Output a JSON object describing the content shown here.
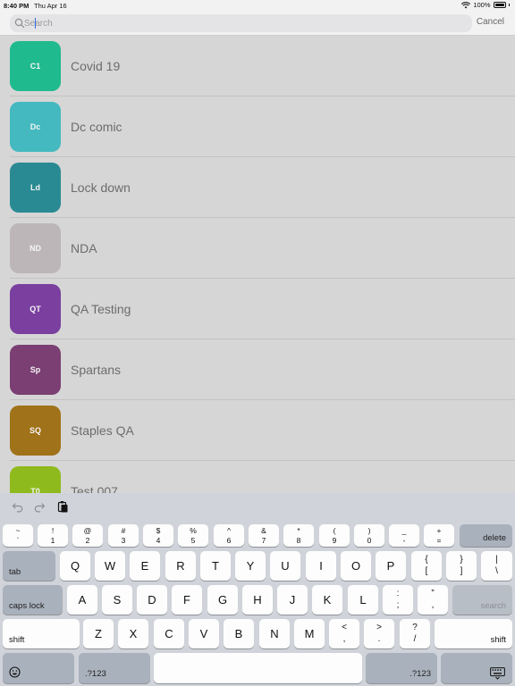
{
  "status_bar": {
    "time": "8:40 PM",
    "date": "Thu Apr 16",
    "battery": "100%"
  },
  "search": {
    "placeholder": "Search",
    "value": "",
    "cancel_label": "Cancel"
  },
  "colors": {
    "accent": "#2d6fe6",
    "list_bg": "#d6d6d6",
    "keyboard_bg": "#d0d3d9"
  },
  "list": {
    "items": [
      {
        "initials": "C1",
        "title": "Covid 19",
        "color": "#1fba8e"
      },
      {
        "initials": "Dc",
        "title": "Dc comic",
        "color": "#44b9bf"
      },
      {
        "initials": "Ld",
        "title": "Lock down",
        "color": "#2a8a93"
      },
      {
        "initials": "ND",
        "title": "NDA",
        "color": "#bdb6b9"
      },
      {
        "initials": "QT",
        "title": "QA Testing",
        "color": "#7a3f9f"
      },
      {
        "initials": "Sp",
        "title": "Spartans",
        "color": "#7b3f73"
      },
      {
        "initials": "SQ",
        "title": "Staples QA",
        "color": "#a07219"
      },
      {
        "initials": "T0",
        "title": "Test 007",
        "color": "#8fba1d"
      }
    ]
  },
  "keyboard": {
    "toolbar": [
      "undo-icon",
      "redo-icon",
      "paste-icon"
    ],
    "row1": [
      {
        "top": "~",
        "bot": "`"
      },
      {
        "top": "!",
        "bot": "1"
      },
      {
        "top": "@",
        "bot": "2"
      },
      {
        "top": "#",
        "bot": "3"
      },
      {
        "top": "$",
        "bot": "4"
      },
      {
        "top": "%",
        "bot": "5"
      },
      {
        "top": "^",
        "bot": "6"
      },
      {
        "top": "&",
        "bot": "7"
      },
      {
        "top": "*",
        "bot": "8"
      },
      {
        "top": "(",
        "bot": "9"
      },
      {
        "top": ")",
        "bot": "0"
      },
      {
        "top": "_",
        "bot": "-"
      },
      {
        "top": "+",
        "bot": "="
      }
    ],
    "delete_label": "delete",
    "tab_label": "tab",
    "row2": [
      "Q",
      "W",
      "E",
      "R",
      "T",
      "Y",
      "U",
      "I",
      "O",
      "P"
    ],
    "row2_punct": [
      {
        "top": "{",
        "bot": "["
      },
      {
        "top": "}",
        "bot": "]"
      },
      {
        "top": "|",
        "bot": "\\"
      }
    ],
    "caps_label": "caps lock",
    "row3": [
      "A",
      "S",
      "D",
      "F",
      "G",
      "H",
      "J",
      "K",
      "L"
    ],
    "row3_punct": [
      {
        "top": ":",
        "bot": ";"
      },
      {
        "top": "”",
        "bot": ","
      }
    ],
    "search_label": "search",
    "shift_label": "shift",
    "row4": [
      "Z",
      "X",
      "C",
      "V",
      "B",
      "N",
      "M"
    ],
    "row4_punct": [
      {
        "top": "<",
        "bot": ","
      },
      {
        "top": ">",
        "bot": "."
      },
      {
        "top": "?",
        "bot": "/"
      }
    ],
    "numbers_label": ".?123",
    "emoji_icon": "emoji-icon",
    "hide_icon": "keyboard-dismiss-icon"
  }
}
